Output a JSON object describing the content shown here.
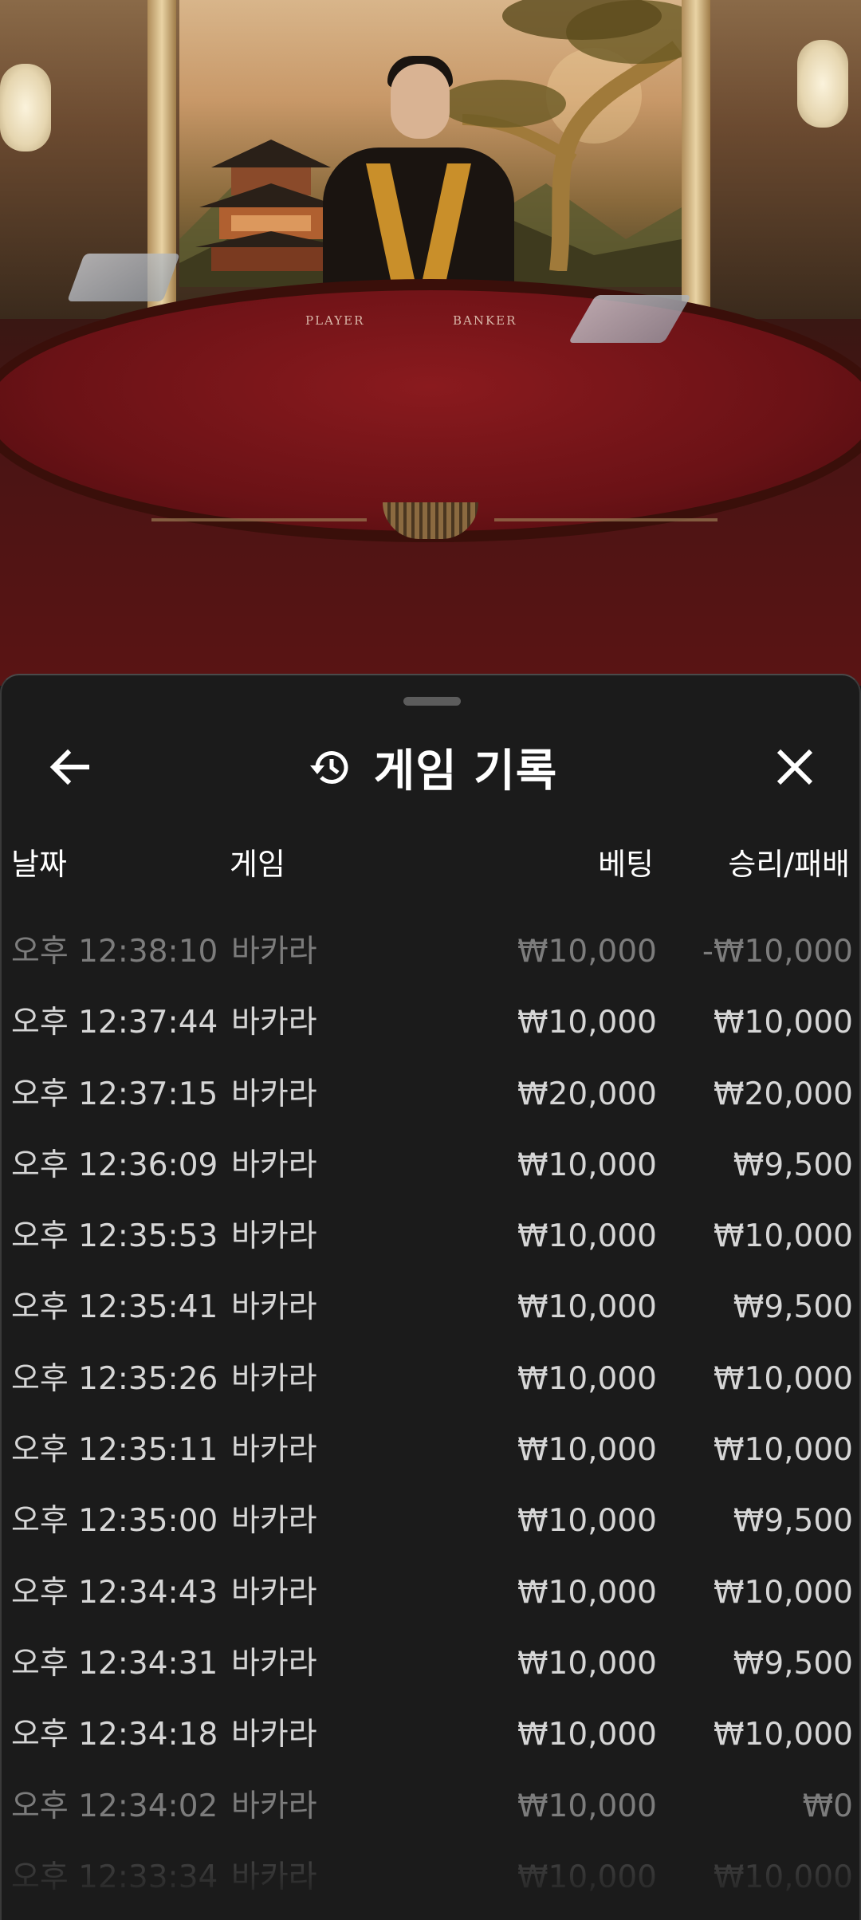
{
  "sheet": {
    "title": "게임 기록",
    "back_icon": "arrow-left-icon",
    "history_icon": "history-icon",
    "close_icon": "close-icon"
  },
  "table_labels": {
    "player": "PLAYER",
    "banker": "BANKER"
  },
  "columns": {
    "date": "날짜",
    "game": "게임",
    "bet": "베팅",
    "result": "승리/패배"
  },
  "rows": [
    {
      "date": "오후 12:38:10",
      "game": "바카라",
      "bet": "₩10,000",
      "result": "-₩10,000"
    },
    {
      "date": "오후 12:37:44",
      "game": "바카라",
      "bet": "₩10,000",
      "result": "₩10,000"
    },
    {
      "date": "오후 12:37:15",
      "game": "바카라",
      "bet": "₩20,000",
      "result": "₩20,000"
    },
    {
      "date": "오후 12:36:09",
      "game": "바카라",
      "bet": "₩10,000",
      "result": "₩9,500"
    },
    {
      "date": "오후 12:35:53",
      "game": "바카라",
      "bet": "₩10,000",
      "result": "₩10,000"
    },
    {
      "date": "오후 12:35:41",
      "game": "바카라",
      "bet": "₩10,000",
      "result": "₩9,500"
    },
    {
      "date": "오후 12:35:26",
      "game": "바카라",
      "bet": "₩10,000",
      "result": "₩10,000"
    },
    {
      "date": "오후 12:35:11",
      "game": "바카라",
      "bet": "₩10,000",
      "result": "₩10,000"
    },
    {
      "date": "오후 12:35:00",
      "game": "바카라",
      "bet": "₩10,000",
      "result": "₩9,500"
    },
    {
      "date": "오후 12:34:43",
      "game": "바카라",
      "bet": "₩10,000",
      "result": "₩10,000"
    },
    {
      "date": "오후 12:34:31",
      "game": "바카라",
      "bet": "₩10,000",
      "result": "₩9,500"
    },
    {
      "date": "오후 12:34:18",
      "game": "바카라",
      "bet": "₩10,000",
      "result": "₩10,000"
    },
    {
      "date": "오후 12:34:02",
      "game": "바카라",
      "bet": "₩10,000",
      "result": "₩0"
    },
    {
      "date": "오후 12:33:34",
      "game": "바카라",
      "bet": "₩10,000",
      "result": "₩10,000"
    }
  ],
  "colors": {
    "sheet_bg": "#1b1b1b",
    "text_primary": "#ffffff",
    "text_row": "#d6d6d6",
    "text_dim": "#7c7c7c",
    "felt": "#6b1216"
  }
}
